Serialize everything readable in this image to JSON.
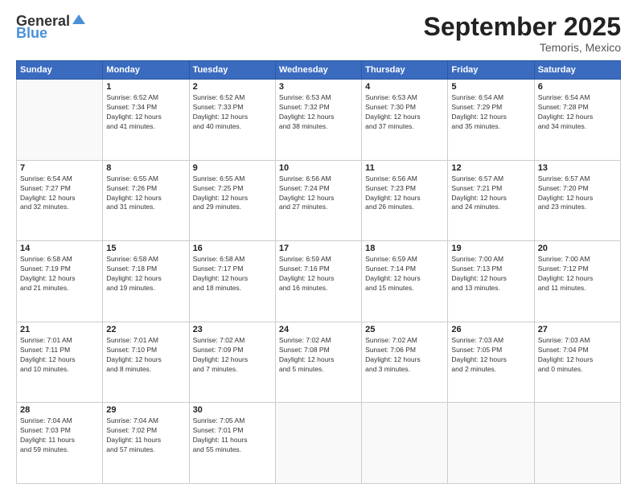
{
  "header": {
    "logo_general": "General",
    "logo_blue": "Blue",
    "title": "September 2025",
    "location": "Temoris, Mexico"
  },
  "calendar": {
    "days_of_week": [
      "Sunday",
      "Monday",
      "Tuesday",
      "Wednesday",
      "Thursday",
      "Friday",
      "Saturday"
    ],
    "weeks": [
      [
        {
          "day": "",
          "info": ""
        },
        {
          "day": "1",
          "info": "Sunrise: 6:52 AM\nSunset: 7:34 PM\nDaylight: 12 hours\nand 41 minutes."
        },
        {
          "day": "2",
          "info": "Sunrise: 6:52 AM\nSunset: 7:33 PM\nDaylight: 12 hours\nand 40 minutes."
        },
        {
          "day": "3",
          "info": "Sunrise: 6:53 AM\nSunset: 7:32 PM\nDaylight: 12 hours\nand 38 minutes."
        },
        {
          "day": "4",
          "info": "Sunrise: 6:53 AM\nSunset: 7:30 PM\nDaylight: 12 hours\nand 37 minutes."
        },
        {
          "day": "5",
          "info": "Sunrise: 6:54 AM\nSunset: 7:29 PM\nDaylight: 12 hours\nand 35 minutes."
        },
        {
          "day": "6",
          "info": "Sunrise: 6:54 AM\nSunset: 7:28 PM\nDaylight: 12 hours\nand 34 minutes."
        }
      ],
      [
        {
          "day": "7",
          "info": "Sunrise: 6:54 AM\nSunset: 7:27 PM\nDaylight: 12 hours\nand 32 minutes."
        },
        {
          "day": "8",
          "info": "Sunrise: 6:55 AM\nSunset: 7:26 PM\nDaylight: 12 hours\nand 31 minutes."
        },
        {
          "day": "9",
          "info": "Sunrise: 6:55 AM\nSunset: 7:25 PM\nDaylight: 12 hours\nand 29 minutes."
        },
        {
          "day": "10",
          "info": "Sunrise: 6:56 AM\nSunset: 7:24 PM\nDaylight: 12 hours\nand 27 minutes."
        },
        {
          "day": "11",
          "info": "Sunrise: 6:56 AM\nSunset: 7:23 PM\nDaylight: 12 hours\nand 26 minutes."
        },
        {
          "day": "12",
          "info": "Sunrise: 6:57 AM\nSunset: 7:21 PM\nDaylight: 12 hours\nand 24 minutes."
        },
        {
          "day": "13",
          "info": "Sunrise: 6:57 AM\nSunset: 7:20 PM\nDaylight: 12 hours\nand 23 minutes."
        }
      ],
      [
        {
          "day": "14",
          "info": "Sunrise: 6:58 AM\nSunset: 7:19 PM\nDaylight: 12 hours\nand 21 minutes."
        },
        {
          "day": "15",
          "info": "Sunrise: 6:58 AM\nSunset: 7:18 PM\nDaylight: 12 hours\nand 19 minutes."
        },
        {
          "day": "16",
          "info": "Sunrise: 6:58 AM\nSunset: 7:17 PM\nDaylight: 12 hours\nand 18 minutes."
        },
        {
          "day": "17",
          "info": "Sunrise: 6:59 AM\nSunset: 7:16 PM\nDaylight: 12 hours\nand 16 minutes."
        },
        {
          "day": "18",
          "info": "Sunrise: 6:59 AM\nSunset: 7:14 PM\nDaylight: 12 hours\nand 15 minutes."
        },
        {
          "day": "19",
          "info": "Sunrise: 7:00 AM\nSunset: 7:13 PM\nDaylight: 12 hours\nand 13 minutes."
        },
        {
          "day": "20",
          "info": "Sunrise: 7:00 AM\nSunset: 7:12 PM\nDaylight: 12 hours\nand 11 minutes."
        }
      ],
      [
        {
          "day": "21",
          "info": "Sunrise: 7:01 AM\nSunset: 7:11 PM\nDaylight: 12 hours\nand 10 minutes."
        },
        {
          "day": "22",
          "info": "Sunrise: 7:01 AM\nSunset: 7:10 PM\nDaylight: 12 hours\nand 8 minutes."
        },
        {
          "day": "23",
          "info": "Sunrise: 7:02 AM\nSunset: 7:09 PM\nDaylight: 12 hours\nand 7 minutes."
        },
        {
          "day": "24",
          "info": "Sunrise: 7:02 AM\nSunset: 7:08 PM\nDaylight: 12 hours\nand 5 minutes."
        },
        {
          "day": "25",
          "info": "Sunrise: 7:02 AM\nSunset: 7:06 PM\nDaylight: 12 hours\nand 3 minutes."
        },
        {
          "day": "26",
          "info": "Sunrise: 7:03 AM\nSunset: 7:05 PM\nDaylight: 12 hours\nand 2 minutes."
        },
        {
          "day": "27",
          "info": "Sunrise: 7:03 AM\nSunset: 7:04 PM\nDaylight: 12 hours\nand 0 minutes."
        }
      ],
      [
        {
          "day": "28",
          "info": "Sunrise: 7:04 AM\nSunset: 7:03 PM\nDaylight: 11 hours\nand 59 minutes."
        },
        {
          "day": "29",
          "info": "Sunrise: 7:04 AM\nSunset: 7:02 PM\nDaylight: 11 hours\nand 57 minutes."
        },
        {
          "day": "30",
          "info": "Sunrise: 7:05 AM\nSunset: 7:01 PM\nDaylight: 11 hours\nand 55 minutes."
        },
        {
          "day": "",
          "info": ""
        },
        {
          "day": "",
          "info": ""
        },
        {
          "day": "",
          "info": ""
        },
        {
          "day": "",
          "info": ""
        }
      ]
    ]
  }
}
